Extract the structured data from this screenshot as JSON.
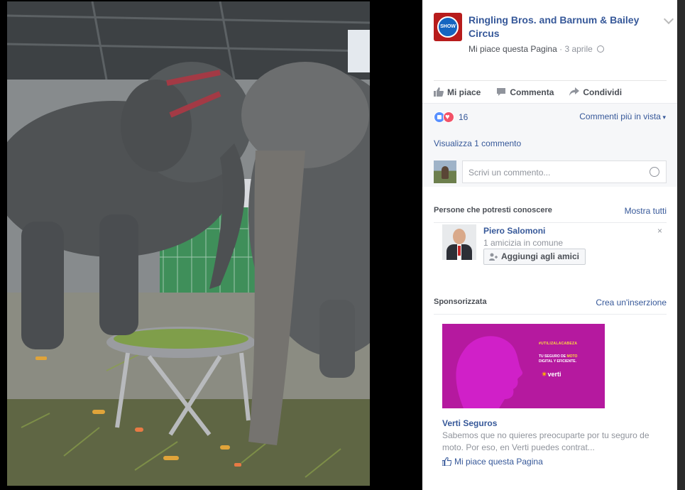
{
  "post": {
    "page_name": "Ringling Bros. and Barnum & Bailey Circus",
    "liked_text": "Mi piace questa Pagina",
    "separator": "·",
    "date": "3 aprile",
    "avatar_text": "SHOW"
  },
  "actions": {
    "like": "Mi piace",
    "comment": "Commenta",
    "share": "Condividi"
  },
  "ufi": {
    "reaction_count": "16",
    "sort_label": "Commenti più in vista",
    "view_comments": "Visualizza 1 commento",
    "comment_placeholder": "Scrivi un commento..."
  },
  "pymk": {
    "title": "Persone che potresti conoscere",
    "see_all": "Mostra tutti",
    "name": "Piero Salomoni",
    "mutual": "1 amicizia in comune",
    "add_button": "Aggiungi agli amici",
    "close": "×"
  },
  "sponsored": {
    "title": "Sponsorizzata",
    "create_ad": "Crea un'inserzione",
    "ad_hashtag": "#UTILIZALACABEZA",
    "ad_copy_pre": "TU SEGURO DE ",
    "ad_copy_highlight": "MOTO",
    "ad_copy_post": "DIGITAL Y EFICIENTE.",
    "ad_logo": "verti",
    "advertiser": "Verti Seguros",
    "description": "Sabemos que no quieres preocuparte por tu seguro de moto. Por eso, en Verti puedes contrat...",
    "like_page": "Mi piace questa Pagina"
  },
  "colors": {
    "link": "#365899",
    "ad_background": "#b5199f",
    "like_reaction": "#5890ff",
    "love_reaction": "#f25268"
  }
}
